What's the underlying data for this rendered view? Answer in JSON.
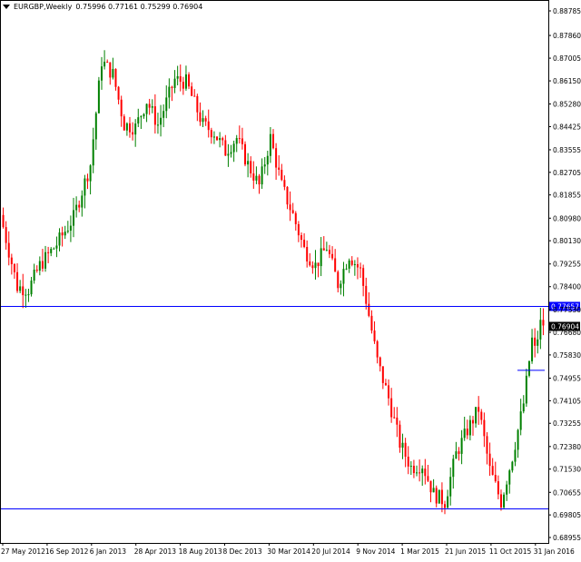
{
  "symbol_header": {
    "symbol": "EURGBP,Weekly",
    "ohlc": "0.75996 0.77161 0.75299 0.76904"
  },
  "colors": {
    "bull": "#008000",
    "bear": "#ff0000",
    "line": "#0000ff",
    "badge_bg": "#000000",
    "badge_text": "#ffffff"
  },
  "chart_data": {
    "type": "candlestick",
    "y_ticks": [
      "0.88785",
      "0.87860",
      "0.87005",
      "0.86150",
      "0.85280",
      "0.84425",
      "0.83555",
      "0.82705",
      "0.81855",
      "0.80980",
      "0.80130",
      "0.79255",
      "0.78400",
      "0.77530",
      "0.76680",
      "0.75830",
      "0.74955",
      "0.74105",
      "0.73255",
      "0.72380",
      "0.71530",
      "0.70655",
      "0.69805",
      "0.68955"
    ],
    "y_range": [
      0.68955,
      0.88785
    ],
    "x_ticks": [
      "27 May 2012",
      "16 Sep 2012",
      "6 Jan 2013",
      "28 Apr 2013",
      "18 Aug 2013",
      "8 Dec 2013",
      "30 Mar 2014",
      "20 Jul 2014",
      "9 Nov 2014",
      "1 Mar 2015",
      "21 Jun 2015",
      "11 Oct 2015",
      "31 Jan 2016"
    ],
    "horizontal_lines": [
      {
        "price": 0.77657,
        "label": "0.77657"
      },
      {
        "price": 0.7003,
        "label": ""
      }
    ],
    "bid_label": "0.76904",
    "bid_price": 0.76904,
    "anchors": [
      [
        0,
        0.811
      ],
      [
        6,
        0.784
      ],
      [
        10,
        0.783
      ],
      [
        14,
        0.792
      ],
      [
        20,
        0.8
      ],
      [
        26,
        0.81
      ],
      [
        32,
        0.83
      ],
      [
        36,
        0.869
      ],
      [
        40,
        0.864
      ],
      [
        44,
        0.845
      ],
      [
        48,
        0.844
      ],
      [
        52,
        0.854
      ],
      [
        56,
        0.845
      ],
      [
        62,
        0.862
      ],
      [
        66,
        0.861
      ],
      [
        72,
        0.845
      ],
      [
        76,
        0.842
      ],
      [
        80,
        0.835
      ],
      [
        84,
        0.84
      ],
      [
        88,
        0.83
      ],
      [
        92,
        0.822
      ],
      [
        96,
        0.84
      ],
      [
        100,
        0.822
      ],
      [
        104,
        0.811
      ],
      [
        108,
        0.798
      ],
      [
        112,
        0.792
      ],
      [
        116,
        0.799
      ],
      [
        120,
        0.785
      ],
      [
        124,
        0.796
      ],
      [
        128,
        0.79
      ],
      [
        130,
        0.779
      ],
      [
        134,
        0.756
      ],
      [
        138,
        0.742
      ],
      [
        142,
        0.725
      ],
      [
        146,
        0.716
      ],
      [
        150,
        0.717
      ],
      [
        154,
        0.706
      ],
      [
        158,
        0.703
      ],
      [
        162,
        0.721
      ],
      [
        166,
        0.73
      ],
      [
        170,
        0.738
      ],
      [
        174,
        0.715
      ],
      [
        178,
        0.703
      ],
      [
        182,
        0.72
      ],
      [
        186,
        0.74
      ],
      [
        189,
        0.764
      ],
      [
        190,
        0.76
      ],
      [
        192,
        0.77
      ]
    ],
    "total_bars": 193
  }
}
